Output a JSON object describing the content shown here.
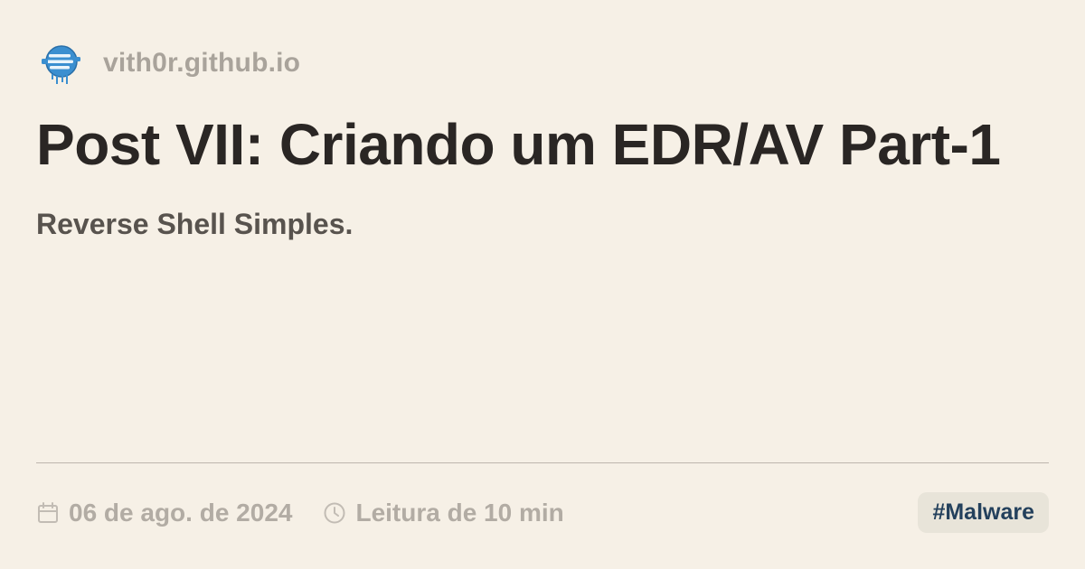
{
  "site": {
    "name": "vith0r.github.io",
    "logo_icon": "globe-logo-icon"
  },
  "post": {
    "title": "Post VII: Criando um EDR/AV Part-1",
    "subtitle": "Reverse Shell Simples."
  },
  "meta": {
    "date": "06 de ago. de 2024",
    "date_icon": "calendar-icon",
    "reading_time": "Leitura de 10 min",
    "reading_icon": "clock-icon"
  },
  "tags": [
    "#Malware"
  ],
  "colors": {
    "background": "#f6f0e6",
    "title": "#2a2624",
    "subtitle": "#58534e",
    "muted": "#b2aca4",
    "tag_background": "#e8e4d9",
    "tag_text": "#23405c",
    "logo_blue": "#3b8fd0"
  }
}
